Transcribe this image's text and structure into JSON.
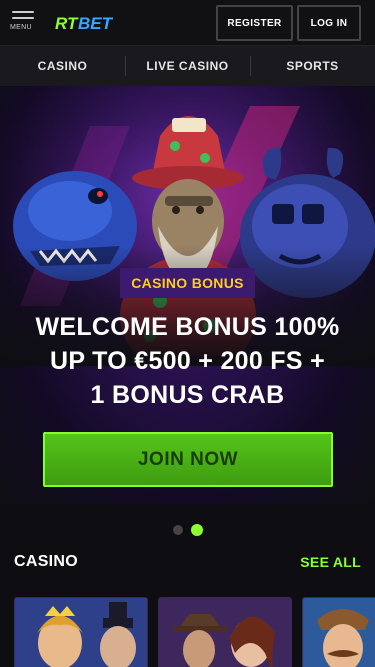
{
  "header": {
    "menu_label": "MENU",
    "logo_text_rt": "RT",
    "logo_text_bet": "BET",
    "register_label": "REGISTER",
    "login_label": "LOG IN"
  },
  "nav": {
    "items": [
      {
        "label": "CASINO"
      },
      {
        "label": "LIVE CASINO"
      },
      {
        "label": "SPORTS"
      }
    ]
  },
  "hero": {
    "bonus_tag": "CASINO BONUS",
    "headline_line1": "WELCOME BONUS 100%",
    "headline_line2": "UP TO €500 + 200 FS +",
    "headline_line3": "1 BONUS CRAB",
    "cta_label": "JOIN NOW",
    "slides_total": 2,
    "active_slide": 2
  },
  "casino_section": {
    "title": "CASINO",
    "see_all_label": "SEE ALL"
  },
  "colors": {
    "accent_green": "#8cff2e",
    "button_green": "#4cb515",
    "bonus_yellow": "#ffcc22",
    "tag_purple": "#3b1a6f",
    "background": "#0e0e12"
  },
  "icons": {
    "menu": "hamburger-icon",
    "logo": "rtbet-logo"
  }
}
